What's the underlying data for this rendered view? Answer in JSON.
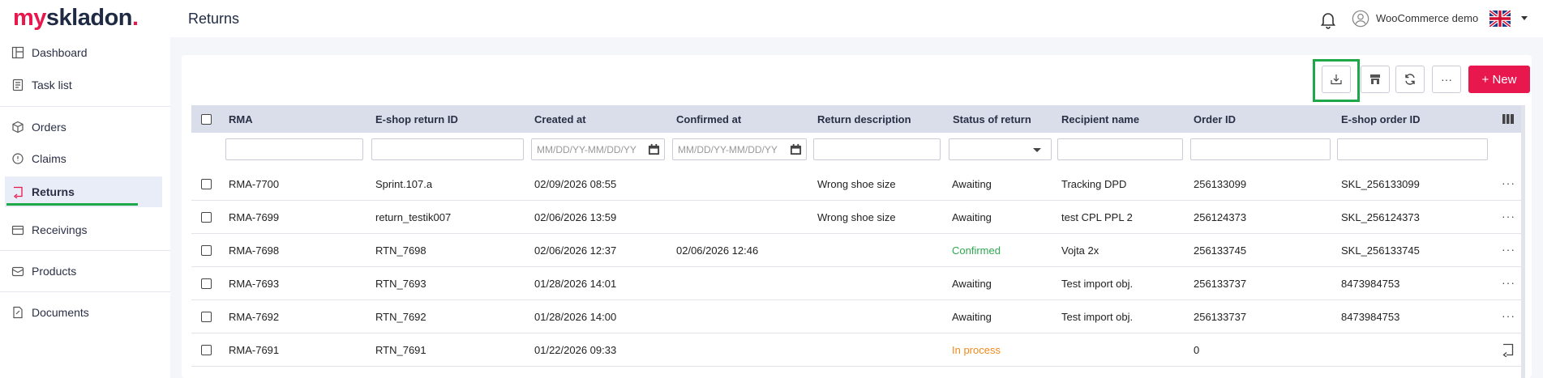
{
  "logo": {
    "my": "my",
    "rest": "skladon",
    "dot": "."
  },
  "page_title": "Returns",
  "user": {
    "name": "WooCommerce demo"
  },
  "sidebar": {
    "items": [
      {
        "label": "Dashboard",
        "icon": "dashboard-icon"
      },
      {
        "label": "Task list",
        "icon": "task-list-icon"
      },
      {
        "label": "Orders",
        "icon": "box-icon"
      },
      {
        "label": "Claims",
        "icon": "claims-icon"
      },
      {
        "label": "Returns",
        "icon": "returns-icon",
        "active": true
      },
      {
        "label": "Receivings",
        "icon": "receivings-icon"
      },
      {
        "label": "Products",
        "icon": "products-icon"
      },
      {
        "label": "Documents",
        "icon": "documents-icon"
      }
    ]
  },
  "toolbar": {
    "new_label": "+ New",
    "more_label": "···"
  },
  "table": {
    "columns": [
      "RMA",
      "E-shop return ID",
      "Created at",
      "Confirmed at",
      "Return description",
      "Status of return",
      "Recipient name",
      "Order ID",
      "E-shop order ID"
    ],
    "date_placeholder": "MM/DD/YY-MM/DD/YY",
    "rows": [
      {
        "rma": "RMA-7700",
        "eshop_return_id": "Sprint.107.a",
        "created": "02/09/2026 08:55",
        "confirmed": "",
        "description": "Wrong shoe size",
        "status": "Awaiting",
        "recipient": "Tracking DPD",
        "order_id": "256133099",
        "eshop_order_id": "SKL_256133099"
      },
      {
        "rma": "RMA-7699",
        "eshop_return_id": "return_testik007",
        "created": "02/06/2026 13:59",
        "confirmed": "",
        "description": "Wrong shoe size",
        "status": "Awaiting",
        "recipient": "test CPL PPL 2",
        "order_id": "256124373",
        "eshop_order_id": "SKL_256124373"
      },
      {
        "rma": "RMA-7698",
        "eshop_return_id": "RTN_7698",
        "created": "02/06/2026 12:37",
        "confirmed": "02/06/2026 12:46",
        "description": "",
        "status": "Confirmed",
        "recipient": "Vojta 2x",
        "order_id": "256133745",
        "eshop_order_id": "SKL_256133745"
      },
      {
        "rma": "RMA-7693",
        "eshop_return_id": "RTN_7693",
        "created": "01/28/2026 14:01",
        "confirmed": "",
        "description": "",
        "status": "Awaiting",
        "recipient": "Test import obj.",
        "order_id": "256133737",
        "eshop_order_id": "8473984753"
      },
      {
        "rma": "RMA-7692",
        "eshop_return_id": "RTN_7692",
        "created": "01/28/2026 14:00",
        "confirmed": "",
        "description": "",
        "status": "Awaiting",
        "recipient": "Test import obj.",
        "order_id": "256133737",
        "eshop_order_id": "8473984753"
      },
      {
        "rma": "RMA-7691",
        "eshop_return_id": "RTN_7691",
        "created": "01/22/2026 09:33",
        "confirmed": "",
        "description": "",
        "status": "In process",
        "recipient": "",
        "order_id": "0",
        "eshop_order_id": ""
      }
    ]
  },
  "colors": {
    "brand": "#e8174d",
    "confirmed": "#2fa84f",
    "in_process": "#f08a1c",
    "highlight": "#1ea84a"
  }
}
